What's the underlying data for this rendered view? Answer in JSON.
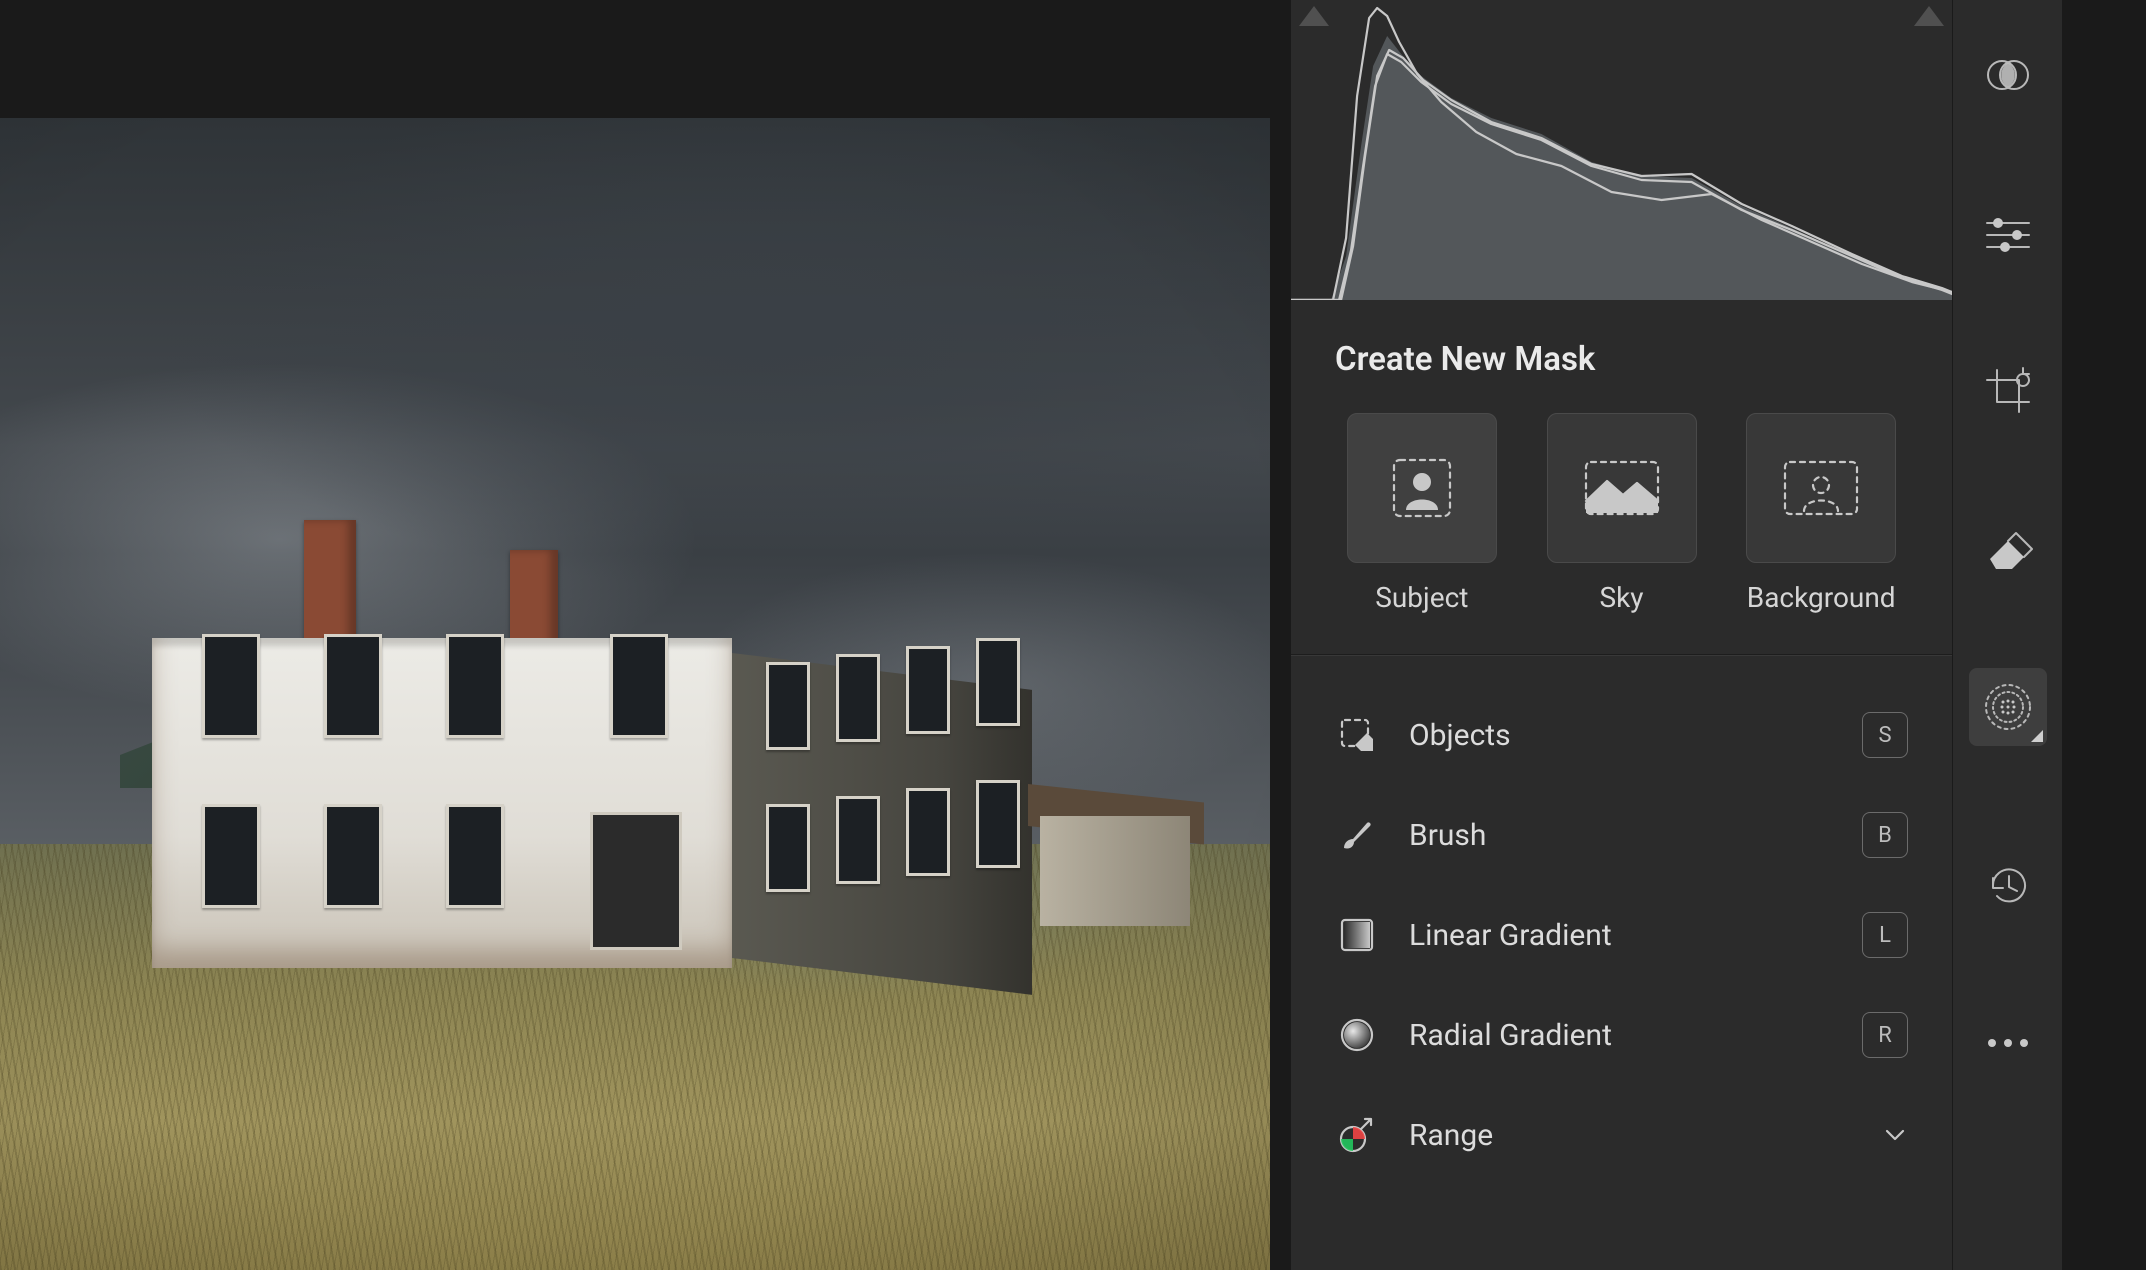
{
  "panel": {
    "title": "Create New Mask",
    "tiles": [
      {
        "id": "subject",
        "label": "Subject"
      },
      {
        "id": "sky",
        "label": "Sky"
      },
      {
        "id": "background",
        "label": "Background"
      }
    ],
    "tools": [
      {
        "id": "objects",
        "label": "Objects",
        "shortcut": "S"
      },
      {
        "id": "brush",
        "label": "Brush",
        "shortcut": "B"
      },
      {
        "id": "linear-gradient",
        "label": "Linear Gradient",
        "shortcut": "L"
      },
      {
        "id": "radial-gradient",
        "label": "Radial Gradient",
        "shortcut": "R"
      },
      {
        "id": "range",
        "label": "Range",
        "shortcut": ""
      }
    ]
  },
  "toolbar": {
    "items": [
      {
        "id": "masking-overlay",
        "icon": "overlay"
      },
      {
        "id": "edit-sliders",
        "icon": "sliders"
      },
      {
        "id": "crop",
        "icon": "crop"
      },
      {
        "id": "healing",
        "icon": "eraser"
      },
      {
        "id": "masking",
        "icon": "mask-circle",
        "active": true
      },
      {
        "id": "versions",
        "icon": "history"
      },
      {
        "id": "more",
        "icon": "dots"
      }
    ]
  }
}
